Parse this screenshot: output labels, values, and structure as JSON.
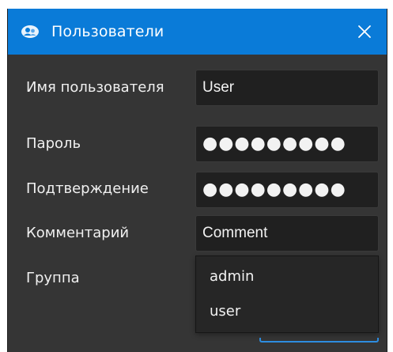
{
  "window": {
    "title": "Пользователи",
    "accent_color": "#0a7bd8",
    "icon": "users-app-icon",
    "close_icon": "close-icon"
  },
  "form": {
    "username": {
      "label": "Имя пользователя",
      "value": "User"
    },
    "password": {
      "label": "Пароль",
      "value": "●●●●●●●●●"
    },
    "confirm": {
      "label": "Подтверждение",
      "value": "●●●●●●●●●"
    },
    "comment": {
      "label": "Комментарий",
      "value": "Comment"
    },
    "group": {
      "label": "Группа",
      "options": [
        "admin",
        "user"
      ]
    }
  }
}
